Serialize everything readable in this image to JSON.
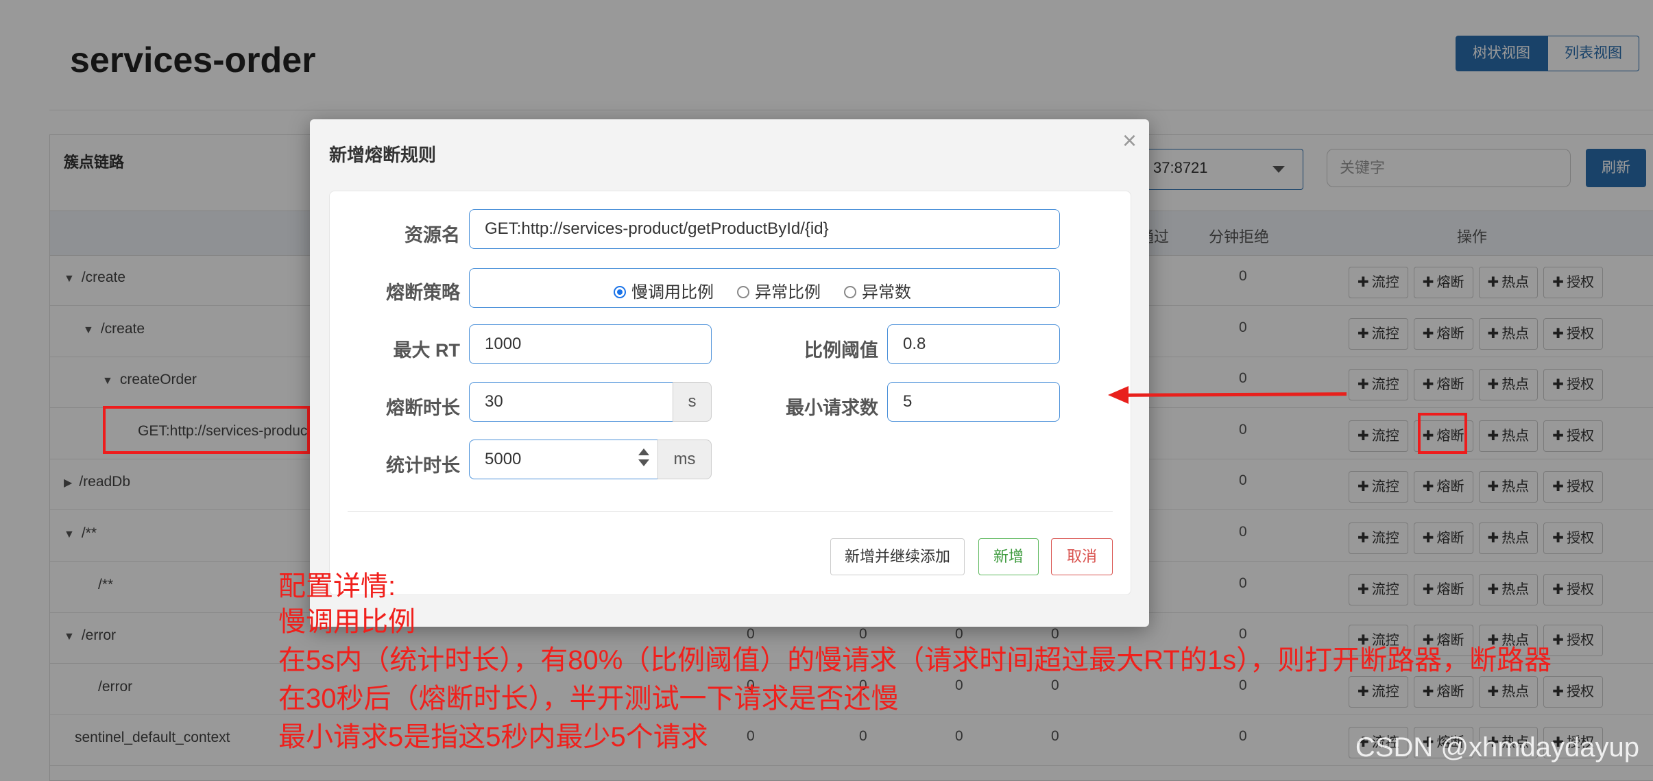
{
  "page": {
    "title": "services-order",
    "view_tree": "树状视图",
    "view_list": "列表视图"
  },
  "panel": {
    "title": "簇点链路",
    "machine_value": "37:8721",
    "keyword_placeholder": "关键字",
    "refresh": "刷新"
  },
  "table": {
    "headers": {
      "passed_suffix": "通过",
      "rejected": "分钟拒绝",
      "ops": "操作"
    },
    "action_labels": {
      "flow": "流控",
      "degrade": "熔断",
      "hot": "热点",
      "auth": "授权"
    },
    "rows": [
      {
        "resource": "/create",
        "toggle": "▼",
        "v1": "",
        "v2": "",
        "v3": "",
        "v4": "",
        "reject": "0"
      },
      {
        "resource": "/create",
        "toggle": "▼",
        "v1": "",
        "v2": "",
        "v3": "",
        "v4": "",
        "reject": "0"
      },
      {
        "resource": "createOrder",
        "toggle": "▼",
        "v1": "",
        "v2": "",
        "v3": "",
        "v4": "",
        "reject": "0"
      },
      {
        "resource": "GET:http://services-produc",
        "toggle": "",
        "v1": "",
        "v2": "",
        "v3": "",
        "v4": "",
        "reject": "0"
      },
      {
        "resource": "/readDb",
        "toggle": "▶",
        "v1": "",
        "v2": "",
        "v3": "",
        "v4": "",
        "reject": "0"
      },
      {
        "resource": "/**",
        "toggle": "▼",
        "v1": "",
        "v2": "",
        "v3": "",
        "v4": "",
        "reject": "0"
      },
      {
        "resource": "/**",
        "toggle": "",
        "v1": "",
        "v2": "",
        "v3": "",
        "v4": "",
        "reject": "0"
      },
      {
        "resource": "/error",
        "toggle": "▼",
        "v1": "0",
        "v2": "0",
        "v3": "0",
        "v4": "0",
        "reject": "0"
      },
      {
        "resource": "/error",
        "toggle": "",
        "v1": "0",
        "v2": "0",
        "v3": "0",
        "v4": "0",
        "reject": "0"
      },
      {
        "resource": "sentinel_default_context",
        "toggle": "",
        "v1": "0",
        "v2": "0",
        "v3": "0",
        "v4": "0",
        "reject": "0"
      }
    ]
  },
  "modal": {
    "title": "新增熔断规则",
    "close": "×",
    "resource_label": "资源名",
    "resource_value": "GET:http://services-product/getProductById/{id}",
    "strategy_label": "熔断策略",
    "strategy_options": [
      "慢调用比例",
      "异常比例",
      "异常数"
    ],
    "strategy_selected": "慢调用比例",
    "max_rt_label": "最大 RT",
    "max_rt_value": "1000",
    "ratio_label": "比例阈值",
    "ratio_value": "0.8",
    "duration_label": "熔断时长",
    "duration_value": "30",
    "duration_unit": "s",
    "min_req_label": "最小请求数",
    "min_req_value": "5",
    "stat_label": "统计时长",
    "stat_value": "5000",
    "stat_unit": "ms",
    "btn_continue": "新增并继续添加",
    "btn_add": "新增",
    "btn_cancel": "取消"
  },
  "annotation": {
    "lines": [
      "配置详情:",
      "慢调用比例",
      "在5s内（统计时长），有80%（比例阈值）的慢请求（请求时间超过最大RT的1s），则打开断路器，断路器",
      "在30秒后（熔断时长），半开测试一下请求是否还慢",
      "最小请求5是指这5秒内最少5个请求"
    ],
    "color": "#f0201c"
  },
  "watermark": "CSDN @xhmdaydayup",
  "colors": {
    "primary": "#2a6fb0",
    "highlight": "#ee1c1c",
    "success": "#5cb85c",
    "danger": "#d9534f"
  }
}
